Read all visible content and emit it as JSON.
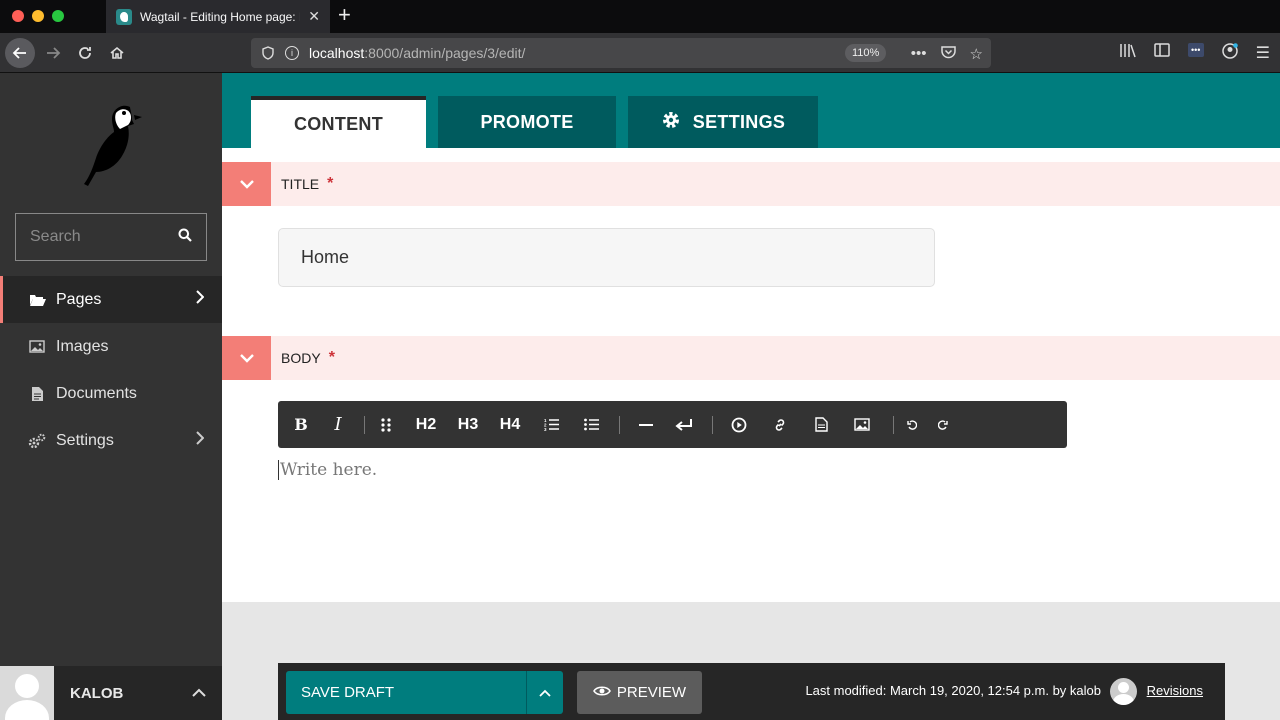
{
  "browser": {
    "tab_title": "Wagtail - Editing Home page: H",
    "url_host": "localhost",
    "url_path": ":8000/admin/pages/3/edit/",
    "zoom": "110%"
  },
  "sidebar": {
    "search_placeholder": "Search",
    "items": [
      {
        "label": "Pages",
        "icon": "folder-open-icon",
        "has_submenu": true,
        "active": true
      },
      {
        "label": "Images",
        "icon": "image-icon",
        "has_submenu": false
      },
      {
        "label": "Documents",
        "icon": "document-icon",
        "has_submenu": false
      },
      {
        "label": "Settings",
        "icon": "cogs-icon",
        "has_submenu": true
      }
    ],
    "account_name": "KALOB"
  },
  "tabs": [
    {
      "label": "CONTENT",
      "active": true
    },
    {
      "label": "PROMOTE"
    },
    {
      "label": "SETTINGS",
      "icon": "gear-icon"
    }
  ],
  "fields": {
    "title_label": "TITLE",
    "required_mark": "*",
    "title_value": "Home",
    "body_label": "BODY",
    "body_placeholder": "Write here."
  },
  "toolbar": {
    "bold": "B",
    "italic": "I",
    "h2": "H2",
    "h3": "H3",
    "h4": "H4"
  },
  "footer": {
    "save_draft": "SAVE DRAFT",
    "preview": "PREVIEW",
    "last_modified": "Last modified: March 19, 2020, 12:54 p.m. by kalob",
    "revisions": "Revisions"
  },
  "colors": {
    "primary_teal": "#007d7e",
    "dark_teal": "#005b5e",
    "sidebar": "#333333",
    "accent_salmon": "#f37e77",
    "required_red": "#cd3238"
  }
}
